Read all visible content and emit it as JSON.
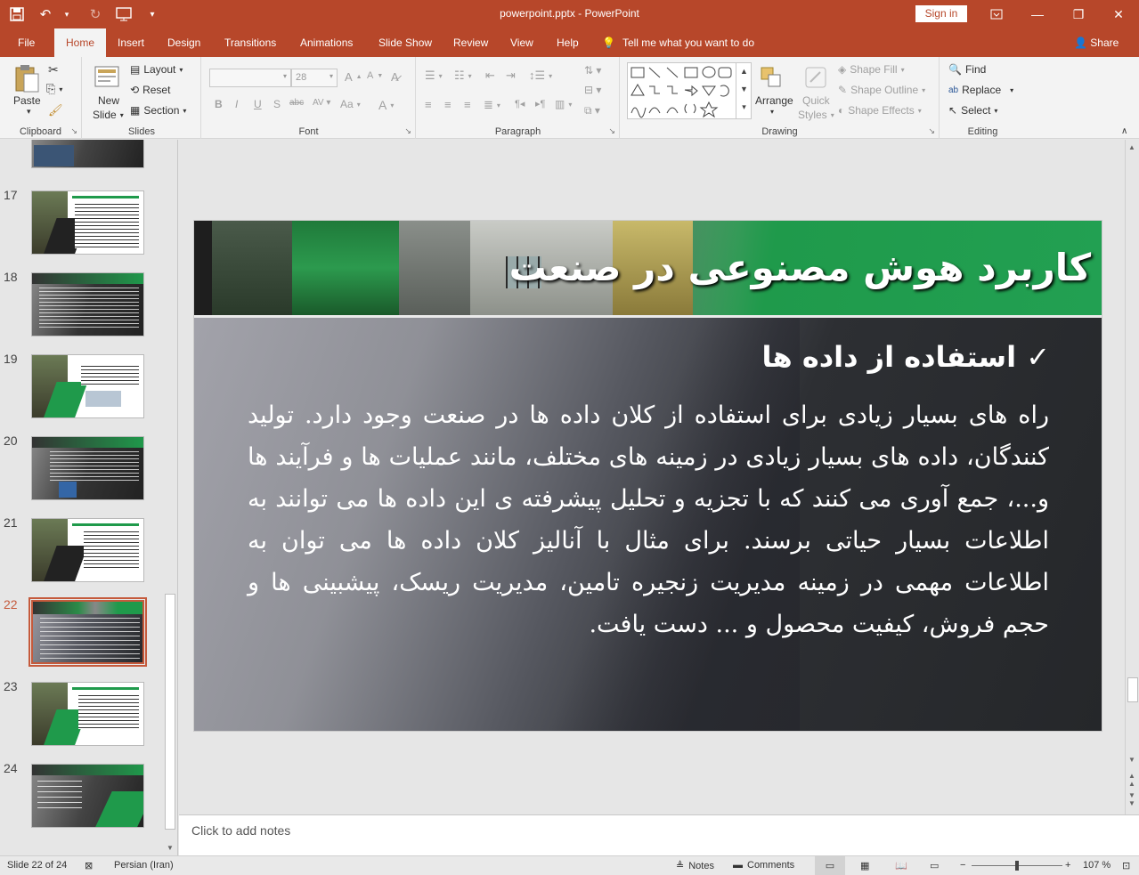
{
  "titlebar": {
    "title": "powerpoint.pptx  -  PowerPoint",
    "signin": "Sign in",
    "accent": "#b7472a"
  },
  "qat": [
    {
      "name": "save-icon",
      "glyph": "💾"
    },
    {
      "name": "undo-icon",
      "glyph": "↶"
    },
    {
      "name": "redo-icon",
      "glyph": "↷"
    },
    {
      "name": "presentation-start-icon",
      "glyph": "▣"
    },
    {
      "name": "customize-qat-icon",
      "glyph": "▾"
    }
  ],
  "tabs": [
    "File",
    "Home",
    "Insert",
    "Design",
    "Transitions",
    "Animations",
    "Slide Show",
    "Review",
    "View",
    "Help"
  ],
  "active_tab": "Home",
  "tellme": "Tell me what you want to do",
  "share": "Share",
  "ribbon": {
    "clipboard": {
      "label": "Clipboard",
      "paste": "Paste"
    },
    "slides": {
      "label": "Slides",
      "new_slide_1": "New",
      "new_slide_2": "Slide",
      "layout": "Layout",
      "reset": "Reset",
      "section": "Section"
    },
    "font": {
      "label": "Font",
      "size": "28",
      "bold": "B",
      "italic": "I",
      "underline": "U",
      "shadow": "S",
      "strike": "abc",
      "case": "Aa"
    },
    "paragraph": {
      "label": "Paragraph"
    },
    "drawing": {
      "label": "Drawing",
      "arrange": "Arrange",
      "quick_styles_1": "Quick",
      "quick_styles_2": "Styles",
      "shape_fill": "Shape Fill",
      "shape_outline": "Shape Outline",
      "shape_effects": "Shape Effects"
    },
    "editing": {
      "label": "Editing",
      "find": "Find",
      "replace": "Replace",
      "select": "Select"
    }
  },
  "thumbnails": [
    {
      "num": "17"
    },
    {
      "num": "18"
    },
    {
      "num": "19"
    },
    {
      "num": "20"
    },
    {
      "num": "21"
    },
    {
      "num": "22"
    },
    {
      "num": "23"
    },
    {
      "num": "24"
    }
  ],
  "slide": {
    "title": "کاربرد هوش مصنوعی در صنعت",
    "heading": "✓ استفاده از داده ها",
    "body": "راه های بسیار زیادی برای استفاده از کلان داده ها در صنعت وجود دارد. تولید کنندگان، داده های بسیار زیادی در زمینه های مختلف، مانند عملیات ها و فرآیند ها و...، جمع آوری می کنند که با تجزیه و تحلیل پیشرفته ی این داده ها می توانند به اطلاعات بسیار حیاتی برسند. برای مثال با آنالیز کلان داده ها می توان به اطلاعات مهمی در زمینه مدیریت زنجیره تامین، مدیریت ریسک، پیشبینی ها و حجم فروش، کیفیت محصول و ... دست یافت."
  },
  "notes_placeholder": "Click to add notes",
  "status": {
    "slide": "Slide 22 of 24",
    "language": "Persian (Iran)",
    "notes": "Notes",
    "comments": "Comments",
    "zoom": "107 %"
  }
}
